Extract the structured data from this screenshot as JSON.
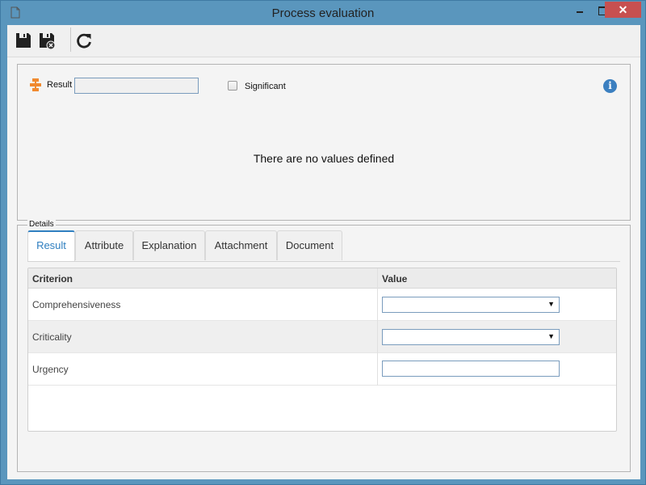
{
  "window": {
    "title": "Process evaluation",
    "close_glyph": "✕",
    "icons": [
      "document-icon",
      "minimize-icon",
      "maximize-icon",
      "close-icon"
    ]
  },
  "toolbar": {
    "buttons": [
      {
        "name": "save",
        "icon": "floppy-disk-icon"
      },
      {
        "name": "save-and-close",
        "icon": "floppy-disk-close-icon"
      },
      {
        "name": "refresh",
        "icon": "refresh-icon"
      }
    ]
  },
  "top_panel": {
    "result_label": "Result",
    "result_value": "",
    "significant_label": "Significant",
    "significant_checked": false,
    "info_glyph": "i",
    "empty_message": "There are no values defined"
  },
  "details": {
    "legend": "Details",
    "tabs": [
      {
        "label": "Result",
        "active": true
      },
      {
        "label": "Attribute",
        "active": false
      },
      {
        "label": "Explanation",
        "active": false
      },
      {
        "label": "Attachment",
        "active": false
      },
      {
        "label": "Document",
        "active": false
      }
    ],
    "grid": {
      "columns": [
        "Criterion",
        "Value"
      ],
      "rows": [
        {
          "criterion": "Comprehensiveness",
          "type": "select",
          "value": ""
        },
        {
          "criterion": "Criticality",
          "type": "select",
          "value": ""
        },
        {
          "criterion": "Urgency",
          "type": "text",
          "value": ""
        }
      ],
      "caret_glyph": "▼"
    }
  },
  "colors": {
    "titlebar": "#5a96bd",
    "close_button": "#c75050",
    "accent": "#2f7fc0",
    "result_icon": "#f08a30"
  }
}
